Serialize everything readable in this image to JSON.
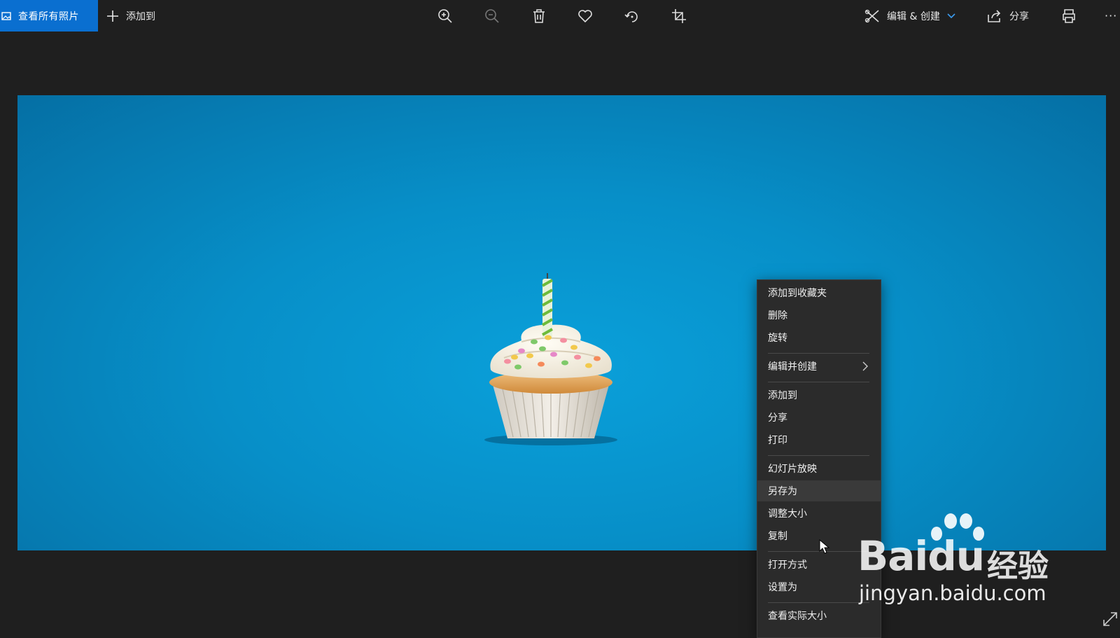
{
  "toolbar": {
    "view_all_label": "查看所有照片",
    "add_to_label": "添加到",
    "edit_create_label": "编辑 & 创建",
    "share_label": "分享",
    "more_label": "···",
    "icons": [
      "zoom-in-icon",
      "zoom-out-icon",
      "delete-icon",
      "heart-icon",
      "rotate-icon",
      "crop-icon",
      "edit-create-icon",
      "share-icon",
      "print-icon"
    ]
  },
  "context_menu": {
    "items": [
      {
        "label": "添加到收藏夹"
      },
      {
        "label": "删除"
      },
      {
        "label": "旋转"
      },
      {
        "label": "编辑并创建",
        "submenu": true
      },
      {
        "label": "添加到"
      },
      {
        "label": "分享"
      },
      {
        "label": "打印"
      },
      {
        "label": "幻灯片放映"
      },
      {
        "label": "另存为",
        "highlighted": true
      },
      {
        "label": "调整大小"
      },
      {
        "label": "复制"
      },
      {
        "label": "打开方式"
      },
      {
        "label": "设置为"
      },
      {
        "label": "查看实际大小"
      }
    ]
  },
  "watermark": {
    "brand": "Bai",
    "brand_du": "du",
    "product": "经验",
    "url": "jingyan.baidu.com"
  },
  "colors": {
    "accent": "#0a6fd0",
    "toolbar_bg": "#1f1f1f",
    "menu_bg": "#2b2b2b",
    "photo_bg": "#0a9ad6"
  }
}
